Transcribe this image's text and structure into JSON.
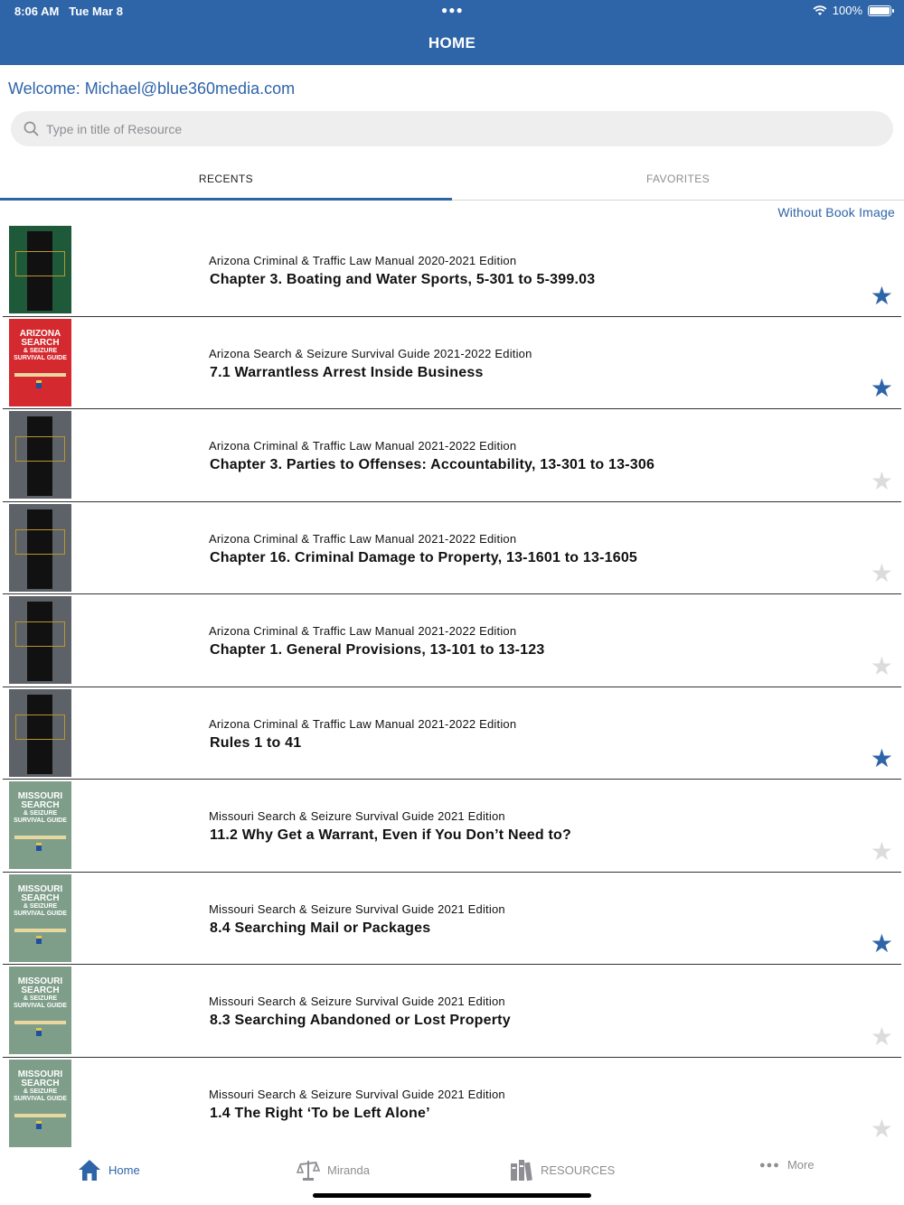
{
  "status": {
    "time": "8:06 AM",
    "date": "Tue Mar 8",
    "battery": "100%"
  },
  "nav": {
    "title": "HOME"
  },
  "welcome": "Welcome: Michael@blue360media.com",
  "search": {
    "placeholder": "Type in title of Resource"
  },
  "tabs": {
    "recents": "RECENTS",
    "favorites": "FAVORITES"
  },
  "view_toggle": "Without Book Image",
  "accent_color": "#2e64a8",
  "items": [
    {
      "book": "Arizona Criminal & Traffic Law Manual 2020-2021 Edition",
      "chapter": "Chapter 3. Boating and Water Sports, 5-301 to 5-399.03",
      "favorite": true,
      "cover": "green"
    },
    {
      "book": "Arizona Search & Seizure Survival Guide 2021-2022 Edition",
      "chapter": "7.1 Warrantless Arrest Inside Business",
      "favorite": true,
      "cover": "red"
    },
    {
      "book": "Arizona Criminal & Traffic Law Manual 2021-2022 Edition",
      "chapter": "Chapter 3. Parties to Offenses: Accountability, 13-301 to 13-306",
      "favorite": false,
      "cover": "gray"
    },
    {
      "book": "Arizona Criminal & Traffic Law Manual 2021-2022 Edition",
      "chapter": "Chapter 16. Criminal Damage to Property, 13-1601 to 13-1605",
      "favorite": false,
      "cover": "gray"
    },
    {
      "book": "Arizona Criminal & Traffic Law Manual 2021-2022 Edition",
      "chapter": "Chapter 1. General Provisions, 13-101 to 13-123",
      "favorite": false,
      "cover": "gray"
    },
    {
      "book": "Arizona Criminal & Traffic Law Manual 2021-2022 Edition",
      "chapter": "Rules 1 to 41",
      "favorite": true,
      "cover": "gray"
    },
    {
      "book": "Missouri Search & Seizure Survival Guide 2021 Edition",
      "chapter": "11.2 Why Get a Warrant, Even if You Don’t Need to?",
      "favorite": false,
      "cover": "sage"
    },
    {
      "book": "Missouri Search & Seizure Survival Guide 2021 Edition",
      "chapter": "8.4 Searching Mail or Packages",
      "favorite": true,
      "cover": "sage"
    },
    {
      "book": "Missouri Search & Seizure Survival Guide 2021 Edition",
      "chapter": "8.3 Searching Abandoned or Lost Property",
      "favorite": false,
      "cover": "sage"
    },
    {
      "book": "Missouri Search & Seizure Survival Guide 2021 Edition",
      "chapter": "1.4 The Right ‘To be Left Alone’",
      "favorite": false,
      "cover": "sage"
    }
  ],
  "covers": {
    "red": {
      "bg": "#d42a2f",
      "lines": [
        "ARIZONA",
        "SEARCH",
        "& SEIZURE",
        "SURVIVAL GUIDE"
      ]
    },
    "sage": {
      "bg": "#7f9e8a",
      "lines": [
        "MISSOURI",
        "SEARCH",
        "& SEIZURE",
        "SURVIVAL GUIDE"
      ]
    },
    "green": {
      "bg": "#1e5a3a"
    },
    "gray": {
      "bg": "#5d6168"
    }
  },
  "tabbar": [
    {
      "label": "Home",
      "icon": "house-icon",
      "active": true
    },
    {
      "label": "Miranda",
      "icon": "scales-icon",
      "active": false
    },
    {
      "label": "RESOURCES",
      "icon": "books-icon",
      "active": false
    },
    {
      "label": "More",
      "icon": "ellipsis-icon",
      "active": false
    }
  ]
}
